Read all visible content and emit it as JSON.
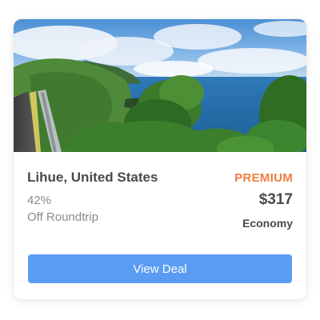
{
  "card": {
    "destination": "Lihue, United States",
    "discount_percent": "42%",
    "discount_label": "Off Roundtrip",
    "badge": "PREMIUM",
    "price": "$317",
    "cabin_class": "Economy",
    "cta_label": "View Deal",
    "image_icon": "coastal-road-photo"
  },
  "colors": {
    "badge": "#ee7d3e",
    "button": "#5b9cf3",
    "text_dark": "#4a4a4a",
    "text_muted": "#8a8a8a"
  }
}
